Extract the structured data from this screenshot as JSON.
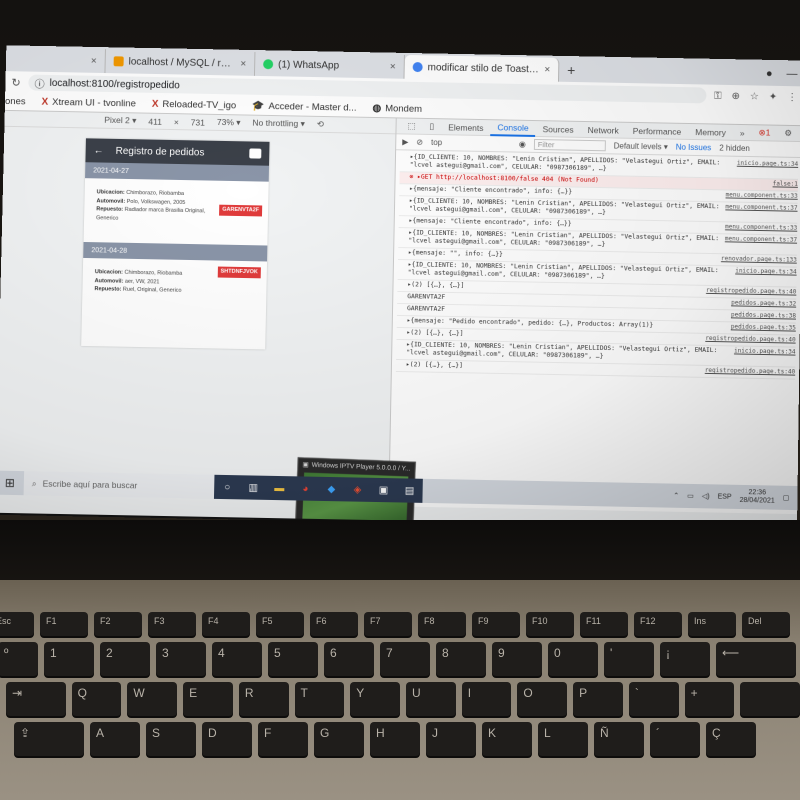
{
  "browser": {
    "tabs": [
      {
        "title": "localhost / MySQL / repicar / ca",
        "color": "#f29900",
        "active": false
      },
      {
        "title": "(1) WhatsApp",
        "color": "#25d366",
        "active": false
      },
      {
        "title": "modificar stilo de Toast ionic - B",
        "color": "#4285f4",
        "active": true
      }
    ],
    "new_tab": "+",
    "url": "localhost:8100/registropedido",
    "bookmarks": [
      "ones",
      "Xtream UI - tvonline",
      "Reloaded-TV_igo",
      "Acceder - Master d...",
      "Mondem"
    ]
  },
  "device_toolbar": {
    "device": "Pixel 2 ▾",
    "width": "411",
    "times": "×",
    "height": "731",
    "zoom": "73% ▾",
    "throttle": "No throttling ▾"
  },
  "app": {
    "title": "Registro de pedidos",
    "back": "←",
    "orders": [
      {
        "date": "2021-04-27",
        "lines": [
          {
            "label": "Ubicacion:",
            "value": "Chimborazo, Riobamba"
          },
          {
            "label": "Automovil:",
            "value": "Polo, Volkswagen, 2005"
          },
          {
            "label": "Repuesto:",
            "value": "Radiador marca Brasilia Original, Generico"
          }
        ],
        "code": "GARENVTA2F"
      },
      {
        "date": "2021-04-28",
        "lines": [
          {
            "label": "Ubicacion:",
            "value": "Chimborazo, Riobamba"
          },
          {
            "label": "Automovil:",
            "value": "aer, VW, 2021"
          },
          {
            "label": "Repuesto:",
            "value": "Ruel, Original, Generico"
          }
        ],
        "code": "SHTDNFJVOK"
      }
    ]
  },
  "devtools": {
    "tabs": [
      "Elements",
      "Console",
      "Sources",
      "Network",
      "Performance",
      "Memory",
      "»"
    ],
    "active_tab": "Console",
    "context": "top",
    "filter_placeholder": "Filter",
    "levels": "Default levels ▾",
    "issues": "No Issues",
    "hidden": "2 hidden",
    "logs": [
      {
        "text": "▸{ID_CLIENTE: 10, NOMBRES: \"Lenin Cristian\", APELLIDOS: \"Velastegui Ortiz\", EMAIL: \"lcvel astegui@gmail.com\", CELULAR: \"0987306189\", …}",
        "src": "inicio.page.ts:34",
        "type": "log"
      },
      {
        "text": "⊗ ▸GET http://localhost:8100/false 404 (Not Found)",
        "src": "false:1",
        "type": "err"
      },
      {
        "text": "▸{mensaje: \"Cliente encontrado\", info: {…}}",
        "src": "menu.component.ts:33",
        "type": "log"
      },
      {
        "text": "▸{ID_CLIENTE: 10, NOMBRES: \"Lenin Cristian\", APELLIDOS: \"Velastegui Ortiz\", EMAIL: \"lcvel astegui@gmail.com\", CELULAR: \"0987306189\", …}",
        "src": "menu.component.ts:37",
        "type": "log"
      },
      {
        "text": "▸{mensaje: \"Cliente encontrado\", info: {…}}",
        "src": "menu.component.ts:33",
        "type": "log"
      },
      {
        "text": "▸{ID_CLIENTE: 10, NOMBRES: \"Lenin Cristian\", APELLIDOS: \"Velastegui Ortiz\", EMAIL: \"lcvel astegui@gmail.com\", CELULAR: \"0987306189\", …}",
        "src": "menu.component.ts:37",
        "type": "log"
      },
      {
        "text": "▸{mensaje: \"\", info: {…}}",
        "src": "renovador.page.ts:133",
        "type": "log"
      },
      {
        "text": "▸{ID_CLIENTE: 10, NOMBRES: \"Lenin Cristian\", APELLIDOS: \"Velastegui Ortiz\", EMAIL: \"lcvel astegui@gmail.com\", CELULAR: \"0987306189\", …}",
        "src": "inicio.page.ts:34",
        "type": "log"
      },
      {
        "text": "▸(2) [{…}, {…}]",
        "src": "registropedido.page.ts:40",
        "type": "log"
      },
      {
        "text": "GARENVTA2F",
        "src": "pedidos.page.ts:32",
        "type": "log"
      },
      {
        "text": "GARENVTA2F",
        "src": "pedidos.page.ts:38",
        "type": "log"
      },
      {
        "text": "▸{mensaje: \"Pedido encontrado\", pedido: {…}, Productos: Array(1)}",
        "src": "pedidos.page.ts:35",
        "type": "log"
      },
      {
        "text": "▸(2) [{…}, {…}]",
        "src": "registropedido.page.ts:40",
        "type": "log"
      },
      {
        "text": "▸{ID_CLIENTE: 10, NOMBRES: \"Lenin Cristian\", APELLIDOS: \"Velastegui Ortiz\", EMAIL: \"lcvel astegui@gmail.com\", CELULAR: \"0987306189\", …}",
        "src": "inicio.page.ts:34",
        "type": "log"
      },
      {
        "text": "▸(2) [{…}, {…}]",
        "src": "registropedido.page.ts:40",
        "type": "log"
      }
    ]
  },
  "popup": {
    "title": "Windows IPTV Player 5.0.0.0 / Y..."
  },
  "taskbar": {
    "search_placeholder": "Escribe aquí para buscar",
    "lang": "ESP",
    "time": "22:36",
    "date": "28/04/2021"
  },
  "keyboard": {
    "rows": [
      [
        "Esc",
        "F1",
        "F2",
        "F3",
        "F4",
        "F5",
        "F6",
        "F7",
        "F8",
        "F9",
        "F10",
        "F11",
        "F12",
        "Ins",
        "Del"
      ],
      [
        "º",
        "1",
        "2",
        "3",
        "4",
        "5",
        "6",
        "7",
        "8",
        "9",
        "0",
        "'",
        "¡",
        "⟵"
      ],
      [
        "⇥",
        "Q",
        "W",
        "E",
        "R",
        "T",
        "Y",
        "U",
        "I",
        "O",
        "P",
        "`",
        "+",
        ""
      ],
      [
        "⇪",
        "A",
        "S",
        "D",
        "F",
        "G",
        "H",
        "J",
        "K",
        "L",
        "Ñ",
        "´",
        "Ç"
      ]
    ]
  }
}
